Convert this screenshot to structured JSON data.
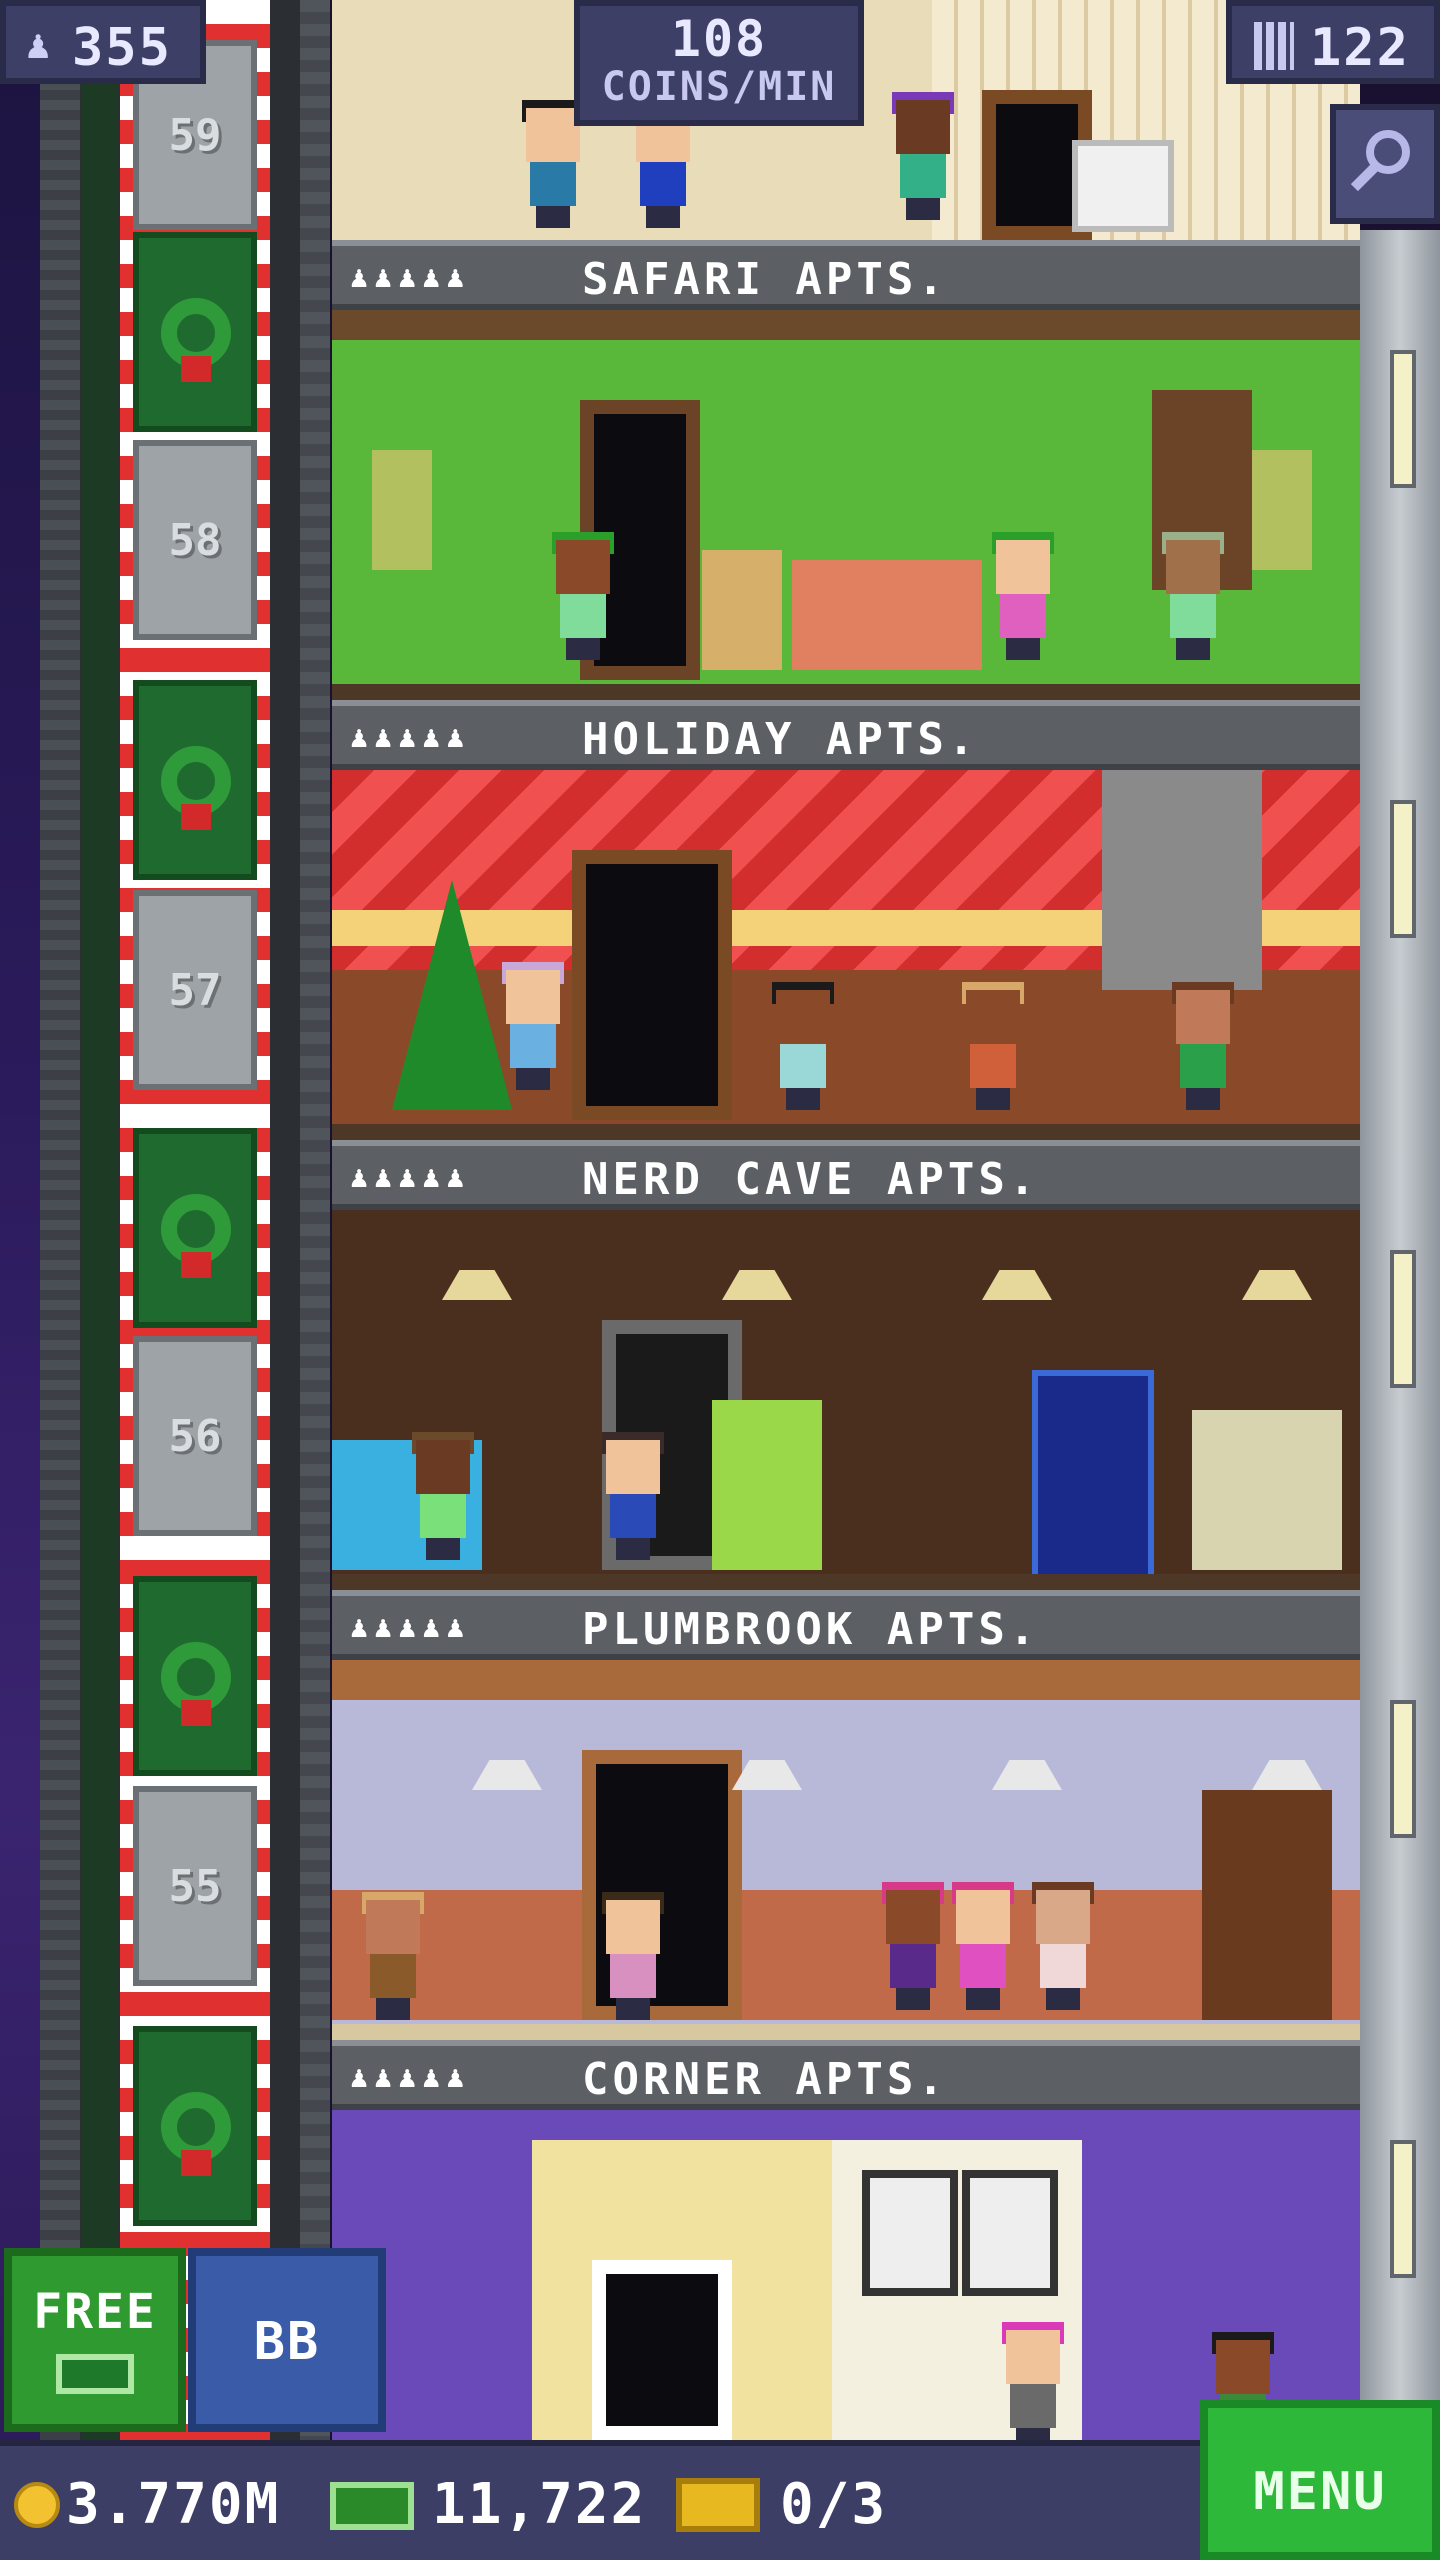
{
  "hud": {
    "population": "355",
    "coin_rate_value": "108",
    "coin_rate_unit": "COINS/MIN",
    "floor_count": "122"
  },
  "elevator": {
    "floor_numbers": [
      "59",
      "58",
      "57",
      "56",
      "55"
    ]
  },
  "floors": [
    {
      "name": "SAFARI APTS.",
      "residents_icon": "♟♟♟♟♟"
    },
    {
      "name": "HOLIDAY APTS.",
      "residents_icon": "♟♟♟♟♟"
    },
    {
      "name": "NERD CAVE APTS.",
      "residents_icon": "♟♟♟♟♟"
    },
    {
      "name": "PLUMBROOK APTS.",
      "residents_icon": "♟♟♟♟♟"
    },
    {
      "name": "CORNER APTS.",
      "residents_icon": "♟♟♟♟♟"
    }
  ],
  "buttons": {
    "free_label": "FREE",
    "bb_label": "BB",
    "menu_label": "MENU"
  },
  "currency": {
    "coins": "3.770M",
    "bux": "11,722",
    "tickets": "0/3"
  },
  "icons": [
    "person-icon",
    "building-icon",
    "zoom-icon",
    "coin-icon",
    "bux-icon",
    "ticket-icon",
    "wreath-icon"
  ],
  "colors": {
    "hud_bg": "#3d3f66",
    "label_bar": "#5c6065",
    "menu_green": "#2db83a",
    "free_green": "#2f9a2f",
    "bb_blue": "#3a5ca8"
  }
}
